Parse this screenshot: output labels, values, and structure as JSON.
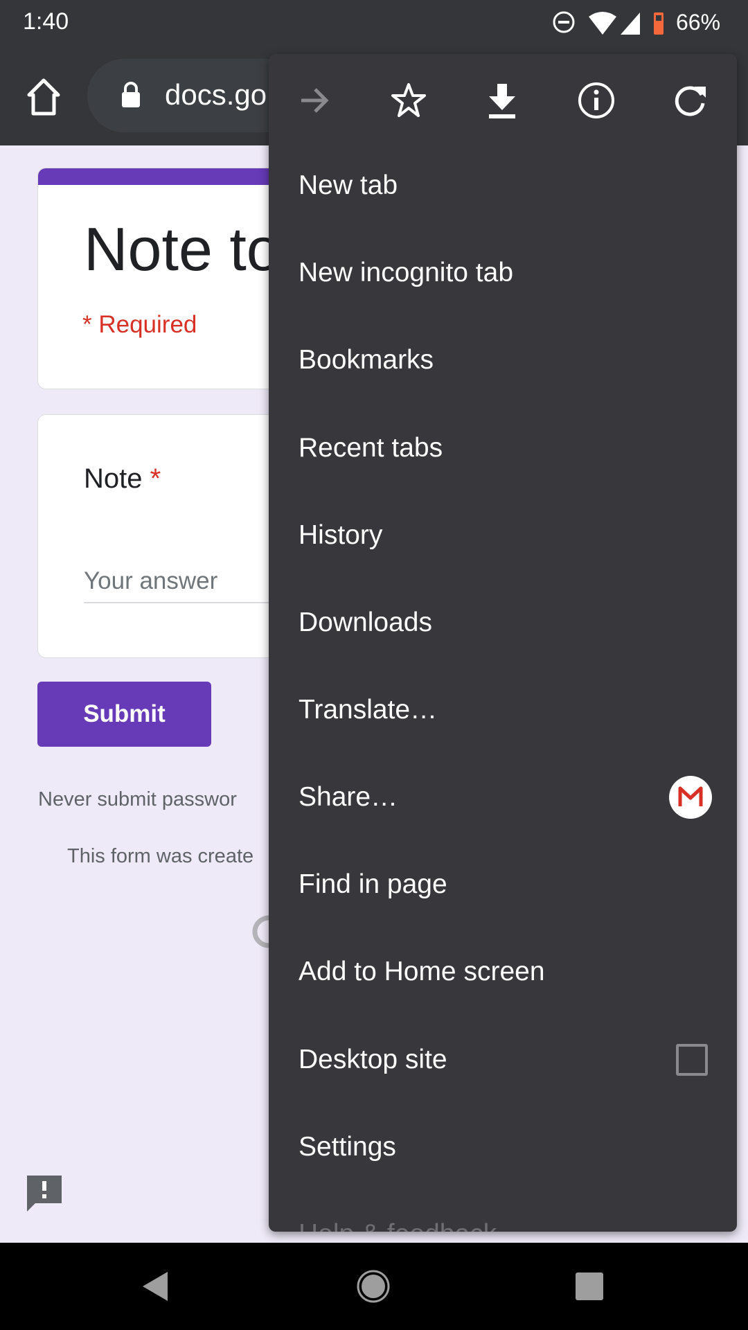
{
  "status_bar": {
    "time": "1:40",
    "battery": "66%"
  },
  "toolbar": {
    "url": "docs.go"
  },
  "form": {
    "title": "Note to",
    "required_note": "* Required",
    "question_label": "Note",
    "required_star": "*",
    "answer_placeholder": "Your answer",
    "submit_label": "Submit",
    "password_warning": "Never submit passwor",
    "created_note": "This form was create",
    "accent": "#673ab7",
    "required_color": "#d93025"
  },
  "menu": {
    "icons": [
      "forward-icon",
      "bookmark-star-icon",
      "download-icon",
      "info-icon",
      "reload-icon"
    ],
    "items": [
      {
        "label": "New tab"
      },
      {
        "label": "New incognito tab"
      },
      {
        "label": "Bookmarks"
      },
      {
        "label": "Recent tabs"
      },
      {
        "label": "History"
      },
      {
        "label": "Downloads"
      },
      {
        "label": "Translate…"
      },
      {
        "label": "Share…"
      },
      {
        "label": "Find in page"
      },
      {
        "label": "Add to Home screen"
      },
      {
        "label": "Desktop site",
        "checked": false
      },
      {
        "label": "Settings"
      },
      {
        "label": "Help & feedback"
      }
    ]
  }
}
